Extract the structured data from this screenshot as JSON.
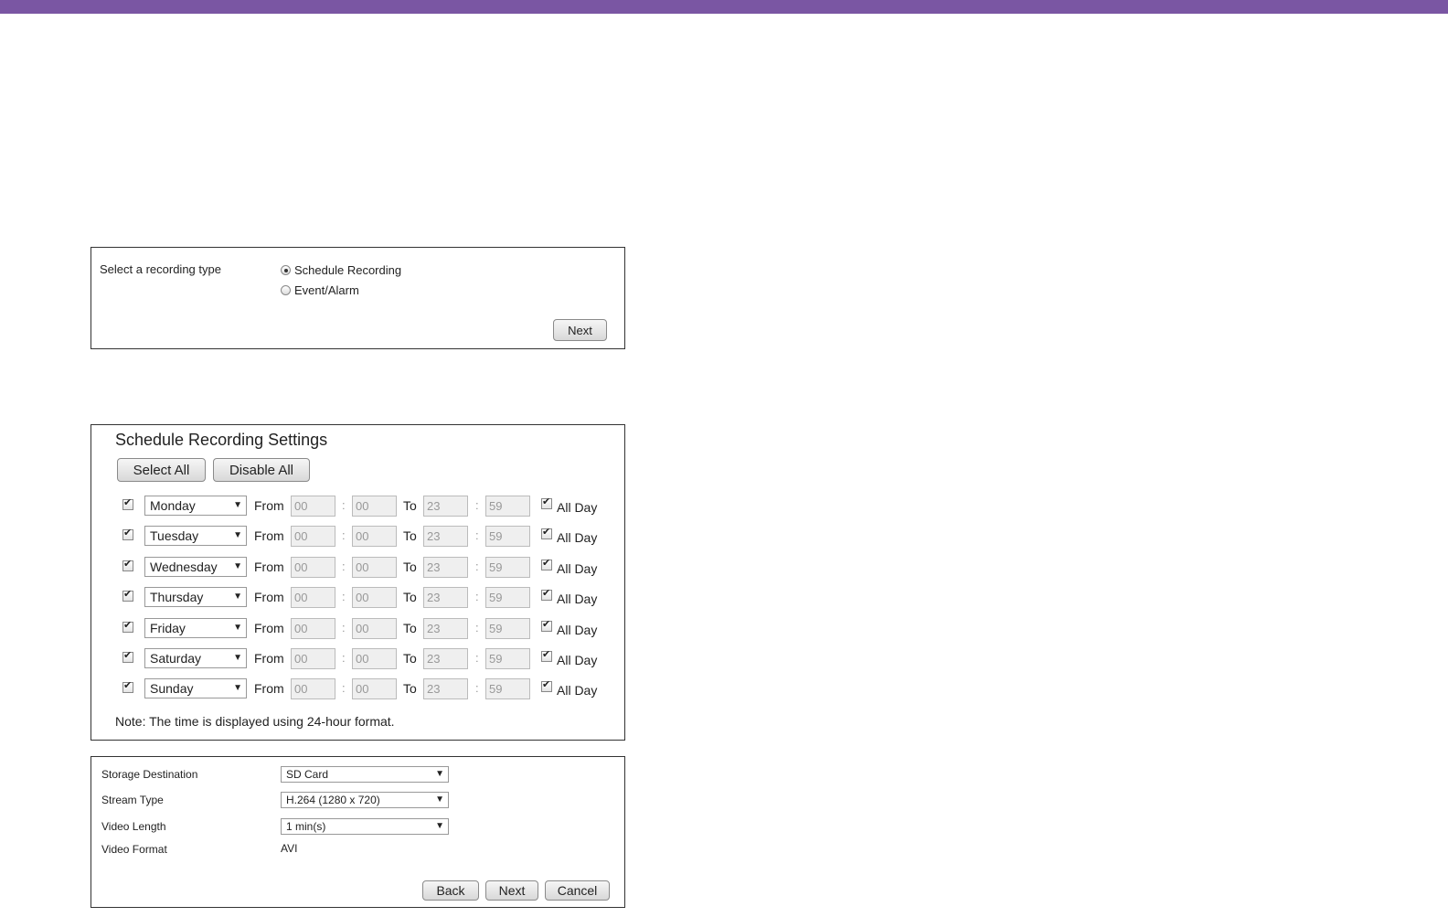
{
  "panel1": {
    "label": "Select a recording type",
    "options": [
      {
        "label": "Schedule Recording",
        "selected": true
      },
      {
        "label": "Event/Alarm",
        "selected": false
      }
    ],
    "next_label": "Next"
  },
  "panel2": {
    "title": "Schedule Recording Settings",
    "select_all_label": "Select All",
    "disable_all_label": "Disable All",
    "from_label": "From",
    "to_label": "To",
    "colon": ":",
    "all_day_label": "All Day",
    "rows": [
      {
        "day": "Monday",
        "from_h": "00",
        "from_m": "00",
        "to_h": "23",
        "to_m": "59"
      },
      {
        "day": "Tuesday",
        "from_h": "00",
        "from_m": "00",
        "to_h": "23",
        "to_m": "59"
      },
      {
        "day": "Wednesday",
        "from_h": "00",
        "from_m": "00",
        "to_h": "23",
        "to_m": "59"
      },
      {
        "day": "Thursday",
        "from_h": "00",
        "from_m": "00",
        "to_h": "23",
        "to_m": "59"
      },
      {
        "day": "Friday",
        "from_h": "00",
        "from_m": "00",
        "to_h": "23",
        "to_m": "59"
      },
      {
        "day": "Saturday",
        "from_h": "00",
        "from_m": "00",
        "to_h": "23",
        "to_m": "59"
      },
      {
        "day": "Sunday",
        "from_h": "00",
        "from_m": "00",
        "to_h": "23",
        "to_m": "59"
      }
    ],
    "note": "Note: The time is displayed using 24-hour format."
  },
  "panel3": {
    "storage_label": "Storage Destination",
    "storage_value": "SD Card",
    "stream_label": "Stream Type",
    "stream_value": "H.264 (1280 x 720)",
    "length_label": "Video Length",
    "length_value": "1 min(s)",
    "format_label": "Video Format",
    "format_value": "AVI",
    "back_label": "Back",
    "next_label": "Next",
    "cancel_label": "Cancel"
  },
  "colors": {
    "topbar": "#7a56a3"
  }
}
